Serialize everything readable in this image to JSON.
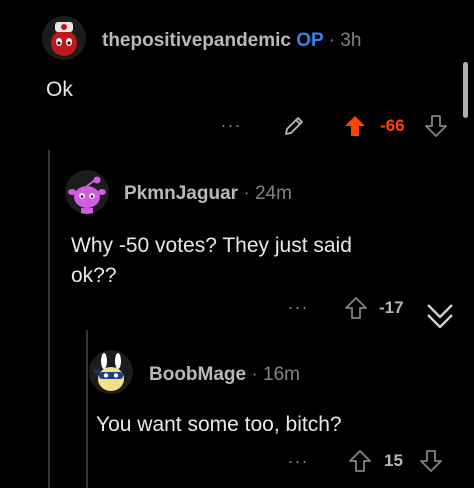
{
  "comments": [
    {
      "username": "thepositivepandemic",
      "op_badge": "OP",
      "separator": "·",
      "time": "3h",
      "body": "Ok",
      "more": "···",
      "score": "-66",
      "vote_state": "upvoted",
      "avatar_color": "#c0181f"
    },
    {
      "username": "PkmnJaguar",
      "separator": "·",
      "time": "24m",
      "body_lines": [
        "Why -50 votes? They just said",
        "ok??"
      ],
      "more": "···",
      "score": "-17",
      "avatar_color": "#d05de0"
    },
    {
      "username": "BoobMage",
      "separator": "·",
      "time": "16m",
      "body": "You want some too, bitch?",
      "more": "···",
      "score": "15",
      "avatar_color": "#f1e189"
    }
  ],
  "colors": {
    "background": "#000000",
    "op_badge": "#3b82e6",
    "upvote_active": "#ff4500",
    "muted": "#818384",
    "thread_line": "#343536"
  },
  "icons": [
    "edit-pencil-icon",
    "upvote-arrow-icon",
    "downvote-arrow-icon",
    "collapse-chevron-icon"
  ]
}
